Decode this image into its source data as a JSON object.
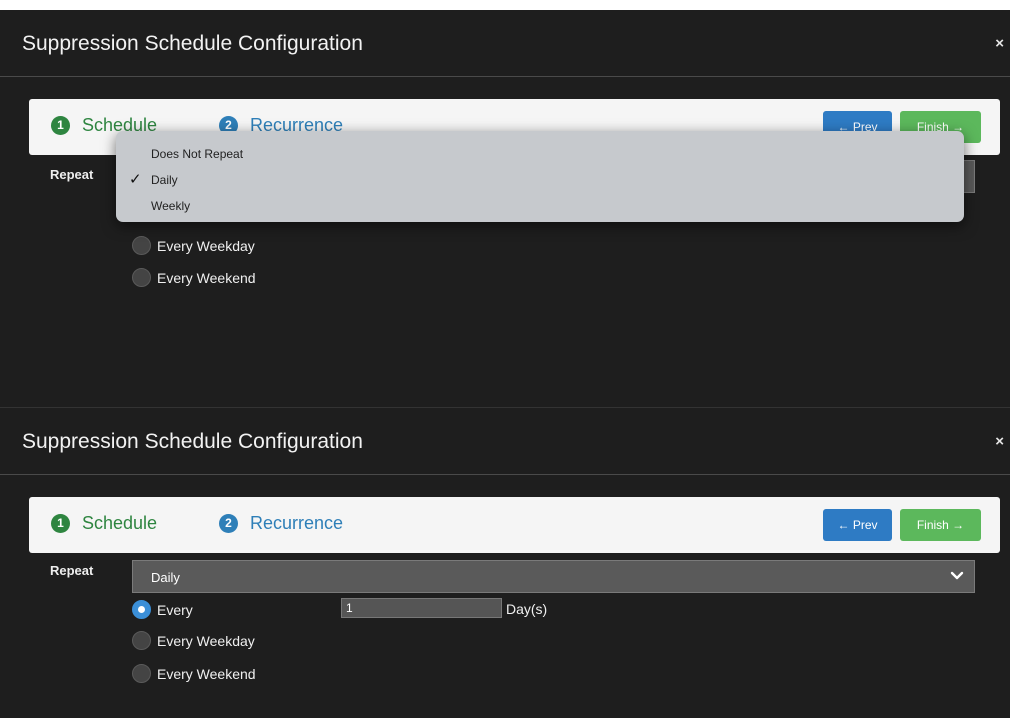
{
  "dialog": {
    "title": "Suppression Schedule Configuration",
    "close_label": "×"
  },
  "wizard": {
    "steps": [
      {
        "number": "1",
        "label": "Schedule"
      },
      {
        "number": "2",
        "label": "Recurrence"
      }
    ],
    "prev_label": "← Prev",
    "finish_label": "Finish →"
  },
  "repeat": {
    "label": "Repeat",
    "selected": "Daily",
    "options": [
      "Does Not Repeat",
      "Daily",
      "Weekly"
    ]
  },
  "recurrence": {
    "every_label": "Every",
    "every_value": "1",
    "every_unit": "Day(s)",
    "weekday_label": "Every Weekday",
    "weekend_label": "Every Weekend"
  },
  "icons": {
    "close": "close-icon",
    "chevron": "chevron-down-icon",
    "check": "checkmark-icon"
  },
  "colors": {
    "step_active": "#2e8540",
    "step_next": "#2e7fb8",
    "prev_button": "#2e7bc4",
    "finish_button": "#5cb85c",
    "radio_selected": "#3b8fd8"
  }
}
